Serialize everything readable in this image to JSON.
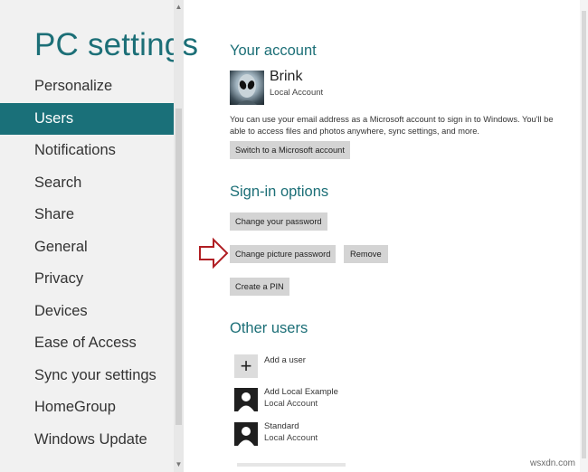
{
  "app": {
    "title": "PC settings"
  },
  "nav": {
    "items": [
      {
        "label": "Personalize"
      },
      {
        "label": "Users",
        "selected": true
      },
      {
        "label": "Notifications"
      },
      {
        "label": "Search"
      },
      {
        "label": "Share"
      },
      {
        "label": "General"
      },
      {
        "label": "Privacy"
      },
      {
        "label": "Devices"
      },
      {
        "label": "Ease of Access"
      },
      {
        "label": "Sync your settings"
      },
      {
        "label": "HomeGroup"
      },
      {
        "label": "Windows Update"
      }
    ]
  },
  "account": {
    "heading": "Your account",
    "name": "Brink",
    "type": "Local Account",
    "description": "You can use your email address as a Microsoft account to sign in to Windows. You'll be able to access files and photos anywhere, sync settings, and more.",
    "switch_label": "Switch to a Microsoft account"
  },
  "signin": {
    "heading": "Sign-in options",
    "change_password_label": "Change your password",
    "change_picture_password_label": "Change picture password",
    "remove_label": "Remove",
    "create_pin_label": "Create a PIN"
  },
  "other_users": {
    "heading": "Other users",
    "add_label": "Add a user",
    "users": [
      {
        "name": "Add Local Example",
        "type": "Local Account"
      },
      {
        "name": "Standard",
        "type": "Local Account"
      }
    ]
  },
  "watermark": "wsxdn.com",
  "colors": {
    "accent": "#1a7079",
    "arrow": "#b01e23",
    "button": "#d4d4d4"
  }
}
